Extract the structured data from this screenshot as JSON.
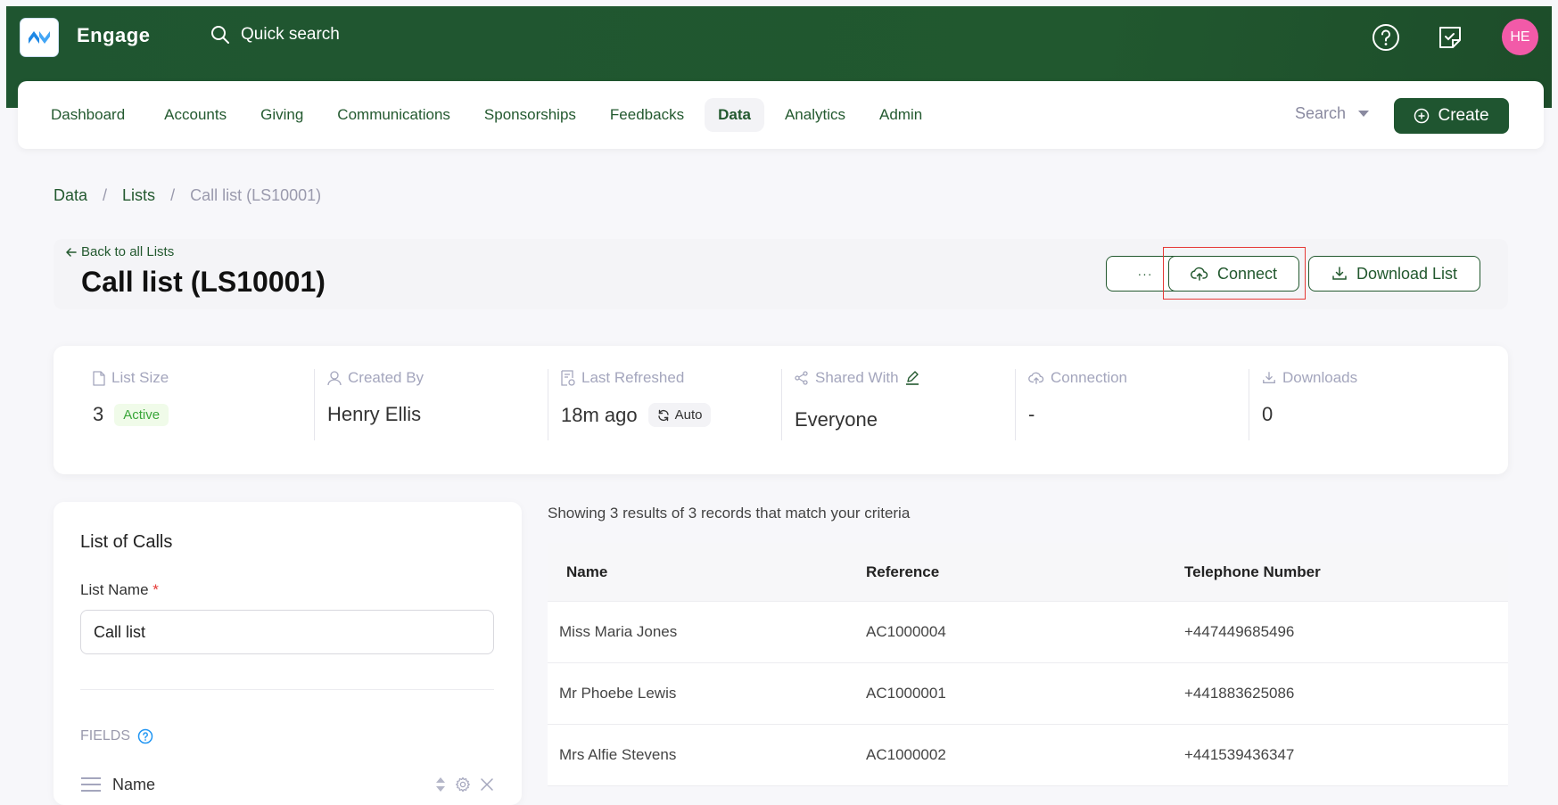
{
  "app": {
    "brand": "Engage",
    "quick_search": "Quick search",
    "user_initials": "HE",
    "colors": {
      "primary": "#1f5530",
      "avatar": "#f25aa8",
      "highlight": "#e53935",
      "active_badge": "#3aa63a"
    }
  },
  "nav": {
    "items": [
      {
        "label": "Dashboard"
      },
      {
        "label": "Accounts"
      },
      {
        "label": "Giving"
      },
      {
        "label": "Communications"
      },
      {
        "label": "Sponsorships"
      },
      {
        "label": "Feedbacks"
      },
      {
        "label": "Data",
        "active": true
      },
      {
        "label": "Analytics"
      },
      {
        "label": "Admin"
      }
    ],
    "search_label": "Search",
    "create_label": "Create"
  },
  "breadcrumb": {
    "items": [
      "Data",
      "Lists",
      "Call list (LS10001)"
    ],
    "separator": "/"
  },
  "header": {
    "back_label": "Back to all Lists",
    "title": "Call list (LS10001)",
    "more_label": "···",
    "connect_label": "Connect",
    "download_label": "Download List"
  },
  "stats": {
    "list_size": {
      "label": "List Size",
      "value": "3",
      "badge": "Active"
    },
    "created_by": {
      "label": "Created By",
      "value": "Henry Ellis"
    },
    "last_refreshed": {
      "label": "Last Refreshed",
      "value": "18m ago",
      "badge": "Auto"
    },
    "shared_with": {
      "label": "Shared With",
      "value": "Everyone"
    },
    "connection": {
      "label": "Connection",
      "value": "-"
    },
    "downloads": {
      "label": "Downloads",
      "value": "0"
    }
  },
  "form": {
    "title": "List of Calls",
    "list_name_label": "List Name",
    "required_mark": "*",
    "list_name_value": "Call list",
    "fields_label": "FIELDS",
    "fields": [
      {
        "name": "Name"
      }
    ]
  },
  "results": {
    "summary": "Showing 3 results of 3 records that match your criteria",
    "columns": [
      "Name",
      "Reference",
      "Telephone Number"
    ],
    "rows": [
      [
        "Miss Maria Jones",
        "AC1000004",
        "+447449685496"
      ],
      [
        "Mr Phoebe Lewis",
        "AC1000001",
        "+441883625086"
      ],
      [
        "Mrs Alfie Stevens",
        "AC1000002",
        "+441539436347"
      ]
    ]
  }
}
